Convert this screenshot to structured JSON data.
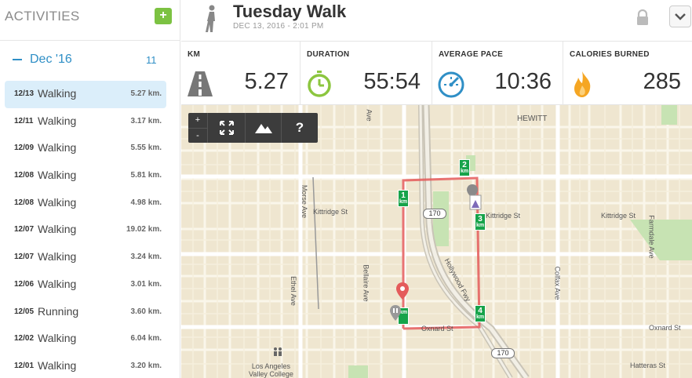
{
  "sidebar": {
    "title": "ACTIVITIES",
    "add_label": "+",
    "month": {
      "label": "Dec '16",
      "count": "11"
    },
    "activities": [
      {
        "date": "12/13",
        "type": "Walking",
        "distance": "5.27 km."
      },
      {
        "date": "12/11",
        "type": "Walking",
        "distance": "3.17 km."
      },
      {
        "date": "12/09",
        "type": "Walking",
        "distance": "5.55 km."
      },
      {
        "date": "12/08",
        "type": "Walking",
        "distance": "5.81 km."
      },
      {
        "date": "12/08",
        "type": "Walking",
        "distance": "4.98 km."
      },
      {
        "date": "12/07",
        "type": "Walking",
        "distance": "19.02 km."
      },
      {
        "date": "12/07",
        "type": "Walking",
        "distance": "3.24 km."
      },
      {
        "date": "12/06",
        "type": "Walking",
        "distance": "3.01 km."
      },
      {
        "date": "12/05",
        "type": "Running",
        "distance": "3.60 km."
      },
      {
        "date": "12/02",
        "type": "Walking",
        "distance": "6.04 km."
      },
      {
        "date": "12/01",
        "type": "Walking",
        "distance": "3.20 km."
      }
    ]
  },
  "header": {
    "title": "Tuesday Walk",
    "subtitle": "DEC 13, 2016  -  2:01 PM"
  },
  "stats": [
    {
      "label": "KM",
      "value": "5.27",
      "icon": "road-icon"
    },
    {
      "label": "DURATION",
      "value": "55:54",
      "icon": "stopwatch-icon"
    },
    {
      "label": "AVERAGE PACE",
      "value": "10:36",
      "icon": "speedometer-icon"
    },
    {
      "label": "CALORIES BURNED",
      "value": "285",
      "icon": "flame-icon"
    }
  ],
  "map": {
    "controls": {
      "zoom_in": "+",
      "zoom_out": "-",
      "help": "?"
    },
    "markers": [
      "1",
      "2",
      "3",
      "4"
    ],
    "marker_unit": "km",
    "streets": {
      "hewitt": "HEWITT",
      "kittridge_left": "Kittridge St",
      "kittridge_mid": "Kittridge St",
      "kittridge_right": "Kittridge St",
      "oxnard_mid": "Oxnard St",
      "oxnard_right": "Oxnard St",
      "hatteras": "Hatteras St",
      "morse": "Morse Ave",
      "ethel": "Ethel Ave",
      "bellaire": "Bellaire Ave",
      "colfax": "Colfax Ave",
      "farmdale": "Farmdale Ave",
      "hollywood_fwy": "Hollywood Fwy",
      "ave_top": "Ave"
    },
    "highway": "170",
    "college": "Los Angeles\nValley College"
  },
  "colors": {
    "accent": "#2f8fc6",
    "green": "#7cc242",
    "route": "#e45b5b",
    "marker": "#17a34a"
  }
}
